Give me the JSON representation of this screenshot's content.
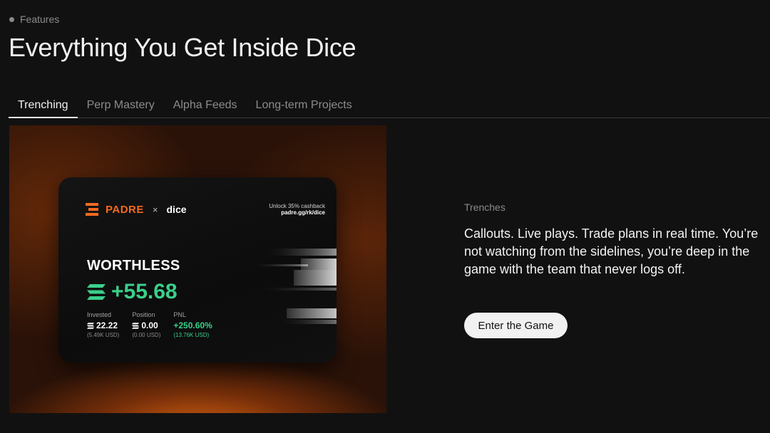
{
  "eyebrow": "Features",
  "title": "Everything You Get Inside Dice",
  "tabs": [
    {
      "label": "Trenching",
      "active": true
    },
    {
      "label": "Perp Mastery",
      "active": false
    },
    {
      "label": "Alpha Feeds",
      "active": false
    },
    {
      "label": "Long-term Projects",
      "active": false
    }
  ],
  "card": {
    "brand": "PADRE",
    "separator": "×",
    "partner": "dice",
    "promo_line1": "Unlock 35% cashback",
    "promo_line2": "padre.gg/rk/dice",
    "status": "WORTHLESS",
    "pnl_value": "+55.68",
    "stats": [
      {
        "label": "Invested",
        "value": "22.22",
        "sub": "(5.49K USD)"
      },
      {
        "label": "Position",
        "value": "0.00",
        "sub": "(0.00 USD)"
      },
      {
        "label": "PNL",
        "value": "+250.60%",
        "sub": "(13.76K USD)"
      }
    ],
    "colors": {
      "brand": "#f26a21",
      "positive": "#3ad08a"
    }
  },
  "section": {
    "label": "Trenches",
    "body": "Callouts. Live plays. Trade plans in real time. You’re not watching from the sidelines, you’re deep in the game with the team that never logs off.",
    "cta": "Enter the Game"
  }
}
